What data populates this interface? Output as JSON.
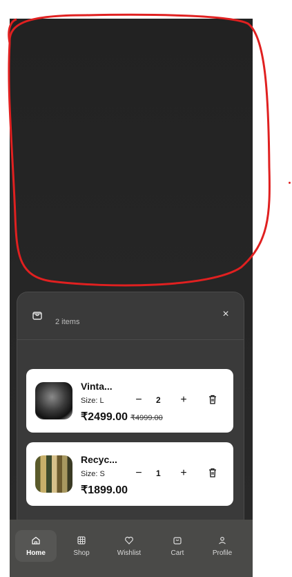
{
  "cart": {
    "count_label": "2 items",
    "close_glyph": "×",
    "items": [
      {
        "title": "Vinta...",
        "size": "Size: L",
        "price": "₹2499.00",
        "old_price": "₹4999.00",
        "qty": "2",
        "minus": "−",
        "plus": "+",
        "image": "hoodie-photo"
      },
      {
        "title": "Recyc...",
        "size": "Size: S",
        "price": "₹1899.00",
        "old_price": "",
        "qty": "1",
        "minus": "−",
        "plus": "+",
        "image": "striped-fabric-photo"
      }
    ]
  },
  "nav": {
    "active": "Home",
    "items": [
      {
        "label": "Home",
        "icon": "home-icon"
      },
      {
        "label": "Shop",
        "icon": "grid-icon"
      },
      {
        "label": "Wishlist",
        "icon": "heart-icon"
      },
      {
        "label": "Cart",
        "icon": "bag-icon"
      },
      {
        "label": "Profile",
        "icon": "user-icon"
      }
    ]
  },
  "colors": {
    "overlay": "#262626",
    "sheet": "#3a3a3a",
    "card": "#ffffff",
    "annotation": "#e02020"
  }
}
